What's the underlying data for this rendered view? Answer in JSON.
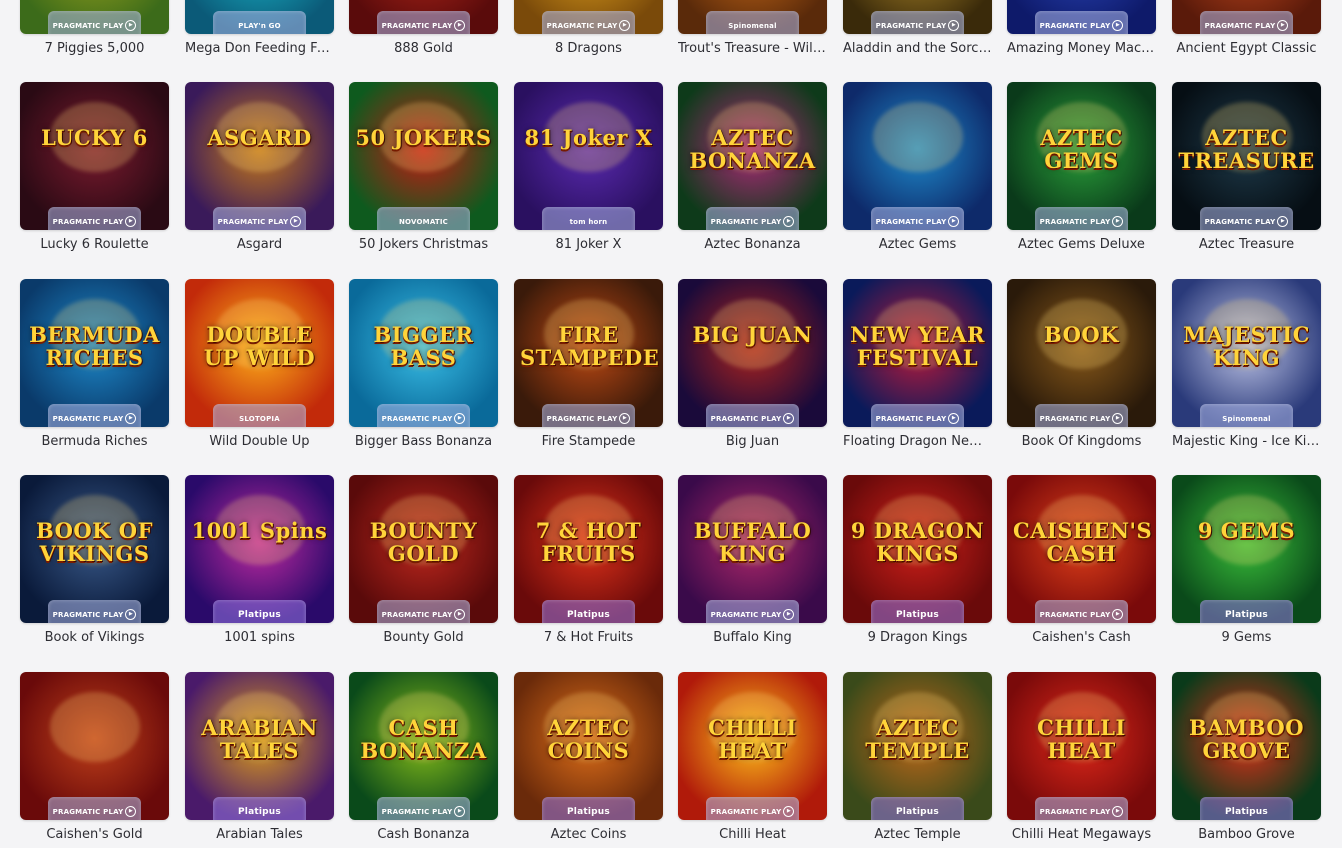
{
  "games": [
    {
      "name": "7 Piggies 5,000",
      "provider": "PRAGMATIC PLAY",
      "art": "",
      "c1": "#3c6b1a",
      "c2": "#9aa21c"
    },
    {
      "name": "Mega Don Feeding Frenzy",
      "provider": "PLAY'n GO",
      "art": "",
      "c1": "#0b5a78",
      "c2": "#19b6c9"
    },
    {
      "name": "888 Gold",
      "provider": "PRAGMATIC PLAY",
      "art": "",
      "c1": "#5a0b0b",
      "c2": "#b3261a"
    },
    {
      "name": "8 Dragons",
      "provider": "PRAGMATIC PLAY",
      "art": "",
      "c1": "#7a4a0a",
      "c2": "#e0a11d"
    },
    {
      "name": "Trout's Treasure - Wild Waters",
      "provider": "Spinomenal",
      "art": "",
      "c1": "#5a2a0a",
      "c2": "#c96a18"
    },
    {
      "name": "Aladdin and the Sorcerer",
      "provider": "PRAGMATIC PLAY",
      "art": "",
      "c1": "#3a2a0a",
      "c2": "#b08a2a"
    },
    {
      "name": "Amazing Money Machine",
      "provider": "PRAGMATIC PLAY",
      "art": "",
      "c1": "#0e1a6a",
      "c2": "#2a45b8"
    },
    {
      "name": "Ancient Egypt Classic",
      "provider": "PRAGMATIC PLAY",
      "art": "",
      "c1": "#5a1a0a",
      "c2": "#c0471e"
    },
    {
      "name": "Lucky 6 Roulette",
      "provider": "PRAGMATIC PLAY",
      "art": "LUCKY 6",
      "c1": "#2a0a14",
      "c2": "#7a1a2e"
    },
    {
      "name": "Asgard",
      "provider": "PRAGMATIC PLAY",
      "art": "ASGARD",
      "c1": "#3a1a5a",
      "c2": "#c67a1a"
    },
    {
      "name": "50 Jokers Christmas",
      "provider": "NOVOMATIC",
      "art": "50 JOKERS",
      "c1": "#0e5a1e",
      "c2": "#c41a14"
    },
    {
      "name": "81 Joker X",
      "provider": "tom horn",
      "art": "81 Joker X",
      "c1": "#2a1060",
      "c2": "#5a2ab0"
    },
    {
      "name": "Aztec Bonanza",
      "provider": "PRAGMATIC PLAY",
      "art": "AZTEC BONANZA",
      "c1": "#0e3a1a",
      "c2": "#b0287a"
    },
    {
      "name": "Aztec Gems",
      "provider": "PRAGMATIC PLAY",
      "art": "",
      "c1": "#0e2a6a",
      "c2": "#1e8acb"
    },
    {
      "name": "Aztec Gems Deluxe",
      "provider": "PRAGMATIC PLAY",
      "art": "AZTEC GEMS",
      "c1": "#0a3a1a",
      "c2": "#2aa03a"
    },
    {
      "name": "Aztec Treasure",
      "provider": "PRAGMATIC PLAY",
      "art": "AZTEC TREASURE",
      "c1": "#060e14",
      "c2": "#1e3a4a"
    },
    {
      "name": "Bermuda Riches",
      "provider": "PRAGMATIC PLAY",
      "art": "BERMUDA RICHES",
      "c1": "#0a3a6a",
      "c2": "#1e8acb"
    },
    {
      "name": "Wild Double Up",
      "provider": "SLOTOPIA",
      "art": "DOUBLE UP WILD",
      "c1": "#c22a0a",
      "c2": "#ffb21a"
    },
    {
      "name": "Bigger Bass Bonanza",
      "provider": "PRAGMATIC PLAY",
      "art": "BIGGER BASS",
      "c1": "#0a6a9a",
      "c2": "#3ac0e8"
    },
    {
      "name": "Fire Stampede",
      "provider": "PRAGMATIC PLAY",
      "art": "FIRE STAMPEDE",
      "c1": "#3a1a0a",
      "c2": "#c04a14"
    },
    {
      "name": "Big Juan",
      "provider": "PRAGMATIC PLAY",
      "art": "BIG JUAN",
      "c1": "#1a0a3a",
      "c2": "#b0241e"
    },
    {
      "name": "Floating Dragon New Year Festival",
      "provider": "PRAGMATIC PLAY",
      "art": "NEW YEAR FESTIVAL",
      "c1": "#0a1a5a",
      "c2": "#c01a3a"
    },
    {
      "name": "Book Of Kingdoms",
      "provider": "PRAGMATIC PLAY",
      "art": "BOOK",
      "c1": "#2a1a0a",
      "c2": "#8a5a1a"
    },
    {
      "name": "Majestic King - Ice Kingdom",
      "provider": "Spinomenal",
      "art": "MAJESTIC KING",
      "c1": "#2a3a7a",
      "c2": "#c0c6e8"
    },
    {
      "name": "Book of Vikings",
      "provider": "PRAGMATIC PLAY",
      "art": "BOOK OF VIKINGS",
      "c1": "#0a1a3a",
      "c2": "#3a5a8a"
    },
    {
      "name": "1001 spins",
      "provider": "Platipus",
      "art": "1001 Spins",
      "c1": "#2a0a6a",
      "c2": "#c02aa0"
    },
    {
      "name": "Bounty Gold",
      "provider": "PRAGMATIC PLAY",
      "art": "BOUNTY GOLD",
      "c1": "#5a0a0a",
      "c2": "#c0281e"
    },
    {
      "name": "7 & Hot Fruits",
      "provider": "Platipus",
      "art": "7 & HOT FRUITS",
      "c1": "#6a0a0a",
      "c2": "#e0321a"
    },
    {
      "name": "Buffalo King",
      "provider": "PRAGMATIC PLAY",
      "art": "BUFFALO KING",
      "c1": "#3a0a4a",
      "c2": "#b0286a"
    },
    {
      "name": "9 Dragon Kings",
      "provider": "Platipus",
      "art": "9 DRAGON KINGS",
      "c1": "#6a0a0a",
      "c2": "#d0201a"
    },
    {
      "name": "Caishen's Cash",
      "provider": "PRAGMATIC PLAY",
      "art": "CAISHEN'S CASH",
      "c1": "#7a0a0a",
      "c2": "#e0401a"
    },
    {
      "name": "9 Gems",
      "provider": "Platipus",
      "art": "9 GEMS",
      "c1": "#0a4a1a",
      "c2": "#3ac03a"
    },
    {
      "name": "Caishen's Gold",
      "provider": "PRAGMATIC PLAY",
      "art": "",
      "c1": "#6a0a0a",
      "c2": "#c0401a"
    },
    {
      "name": "Arabian Tales",
      "provider": "Platipus",
      "art": "ARABIAN TALES",
      "c1": "#4a1a6a",
      "c2": "#e0a01a"
    },
    {
      "name": "Cash Bonanza",
      "provider": "PRAGMATIC PLAY",
      "art": "CASH BONANZA",
      "c1": "#0a4a1a",
      "c2": "#8ac01a"
    },
    {
      "name": "Aztec Coins",
      "provider": "Platipus",
      "art": "AZTEC COINS",
      "c1": "#6a2a0a",
      "c2": "#e0701a"
    },
    {
      "name": "Chilli Heat",
      "provider": "PRAGMATIC PLAY",
      "art": "CHILLI HEAT",
      "c1": "#b01a0a",
      "c2": "#ffc01a"
    },
    {
      "name": "Aztec Temple",
      "provider": "Platipus",
      "art": "AZTEC TEMPLE",
      "c1": "#3a4a1a",
      "c2": "#c0681a"
    },
    {
      "name": "Chilli Heat Megaways",
      "provider": "PRAGMATIC PLAY",
      "art": "CHILLI HEAT",
      "c1": "#7a0a0a",
      "c2": "#e0281a"
    },
    {
      "name": "Bamboo Grove",
      "provider": "Platipus",
      "art": "BAMBOO GROVE",
      "c1": "#0a3a1a",
      "c2": "#e0301a"
    }
  ]
}
